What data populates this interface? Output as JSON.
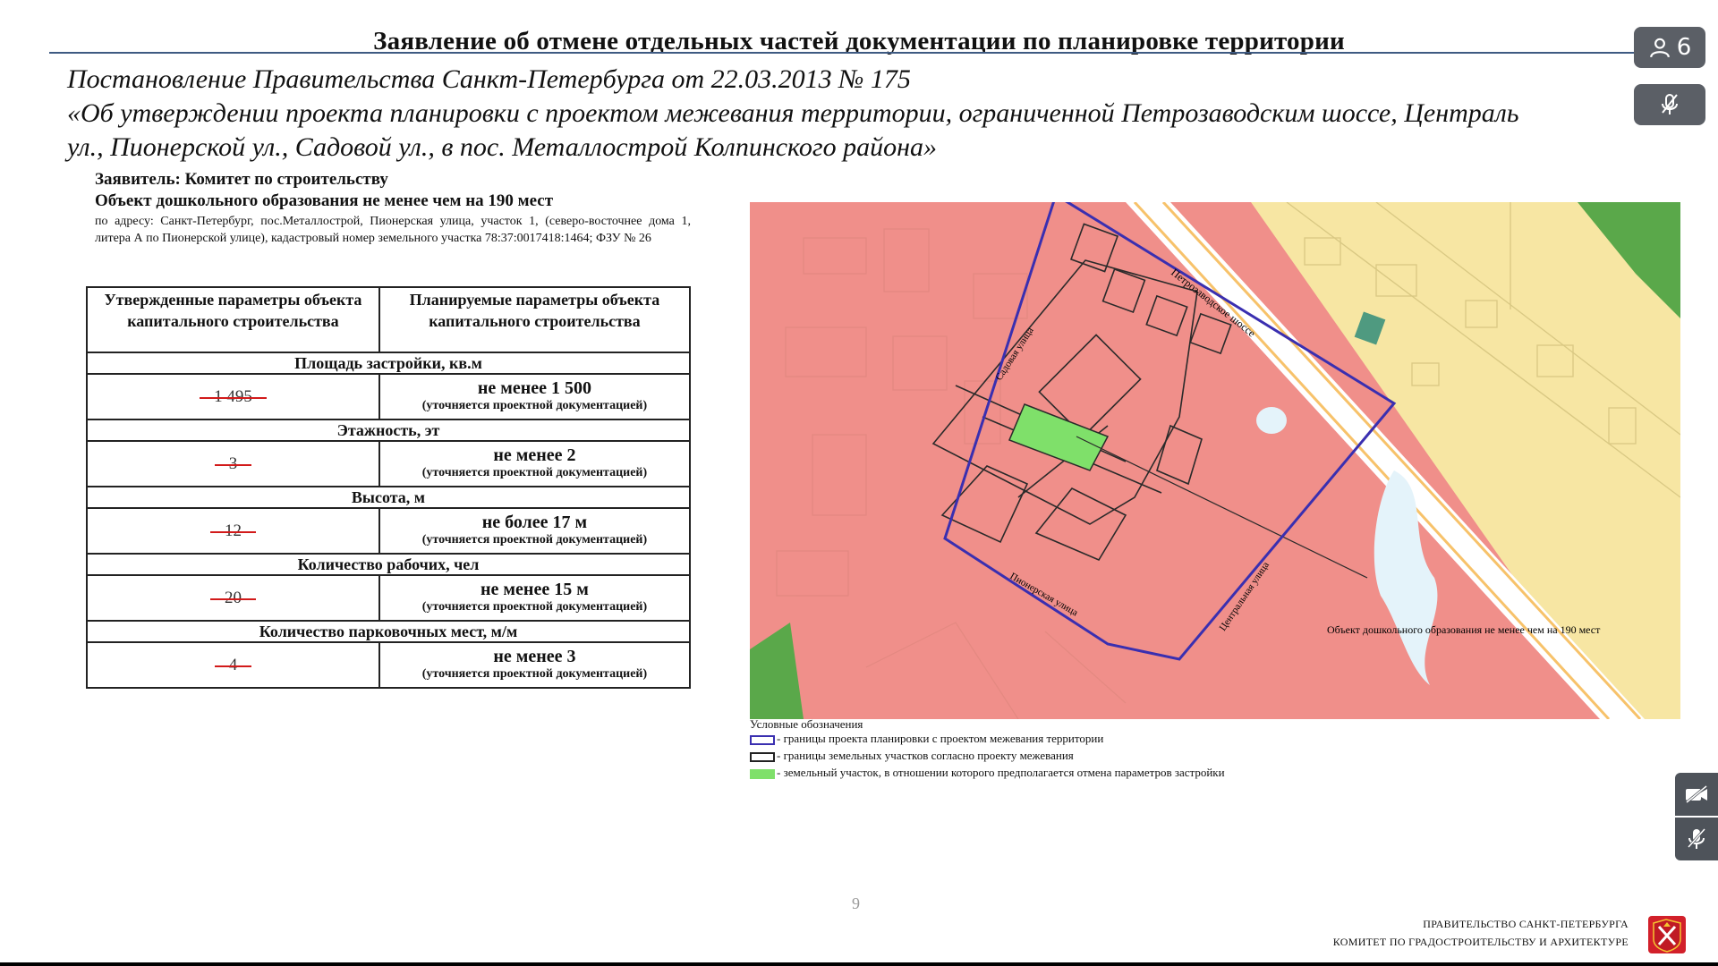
{
  "slide": {
    "title": "Заявление об отмене отдельных частей документации по планировке территории",
    "subtitle_lines": [
      "Постановление Правительства Санкт-Петербурга от 22.03.2013  № 175",
      "«Об утверждении проекта планировки с проектом межевания  территории, ограниченной Петрозаводским шоссе, Централь",
      "ул., Пионерской ул., Садовой ул., в пос. Металлострой Колпинского района»"
    ],
    "applicant": "Заявитель: Комитет по строительству",
    "object": "Объект дошкольного образования не менее чем на 190 мест",
    "address": "по адресу: Санкт-Петербург, пос.Металлострой, Пионерская улица, участок 1, (северо-восточнее дома 1, литера А по Пионерской улице), кадастровый номер земельного участка 78:37:0017418:1464; ФЗУ № 26",
    "page_number": "9"
  },
  "table": {
    "col_headers": [
      "Утвержденные параметры объекта капитального строительства",
      "Планируемые параметры объекта капитального строительства"
    ],
    "note": "(уточняется проектной документацией)",
    "sections": [
      {
        "title": "Площадь застройки, кв.м",
        "old": "1 495",
        "new": "не менее 1 500"
      },
      {
        "title": "Этажность, эт",
        "old": "3",
        "new": "не менее 2"
      },
      {
        "title": "Высота, м",
        "old": "12",
        "new": "не более 17 м"
      },
      {
        "title": "Количество рабочих, чел",
        "old": "20",
        "new": "не менее 15 м"
      },
      {
        "title": "Количество парковочных мест, м/м",
        "old": "4",
        "new": "не менее 3"
      }
    ]
  },
  "map": {
    "streets": {
      "petrozavodskoe": "Петрозаводское шоссе",
      "sadovaya": "Садовая улица",
      "pionerskaya": "Пионерская улица",
      "centralnaya": "Центральная улица"
    },
    "callout": "Объект дошкольного образования не менее чем на 190 мест",
    "colors": {
      "zone": "#f08f8a",
      "residential": "#f7e6a3",
      "highlight": "#7fe06a",
      "boundary": "#3a2fb0",
      "water": "#e4f3fa",
      "green": "#5aa84a"
    }
  },
  "legend": {
    "title": "Условные обозначения",
    "items": [
      {
        "color": "#3a2fb0",
        "label": "- границы проекта планировки с проектом межевания территории"
      },
      {
        "color": "#222222",
        "label": "- границы земельных участков согласно проекту межевания"
      },
      {
        "color": "#7fe06a",
        "label": "- земельный участок, в отношении которого предполагается отмена параметров застройки"
      }
    ]
  },
  "footer": {
    "line1": "ПРАВИТЕЛЬСТВО САНКТ-ПЕТЕРБУРГА",
    "line2": "КОМИТЕТ ПО ГРАДОСТРОИТЕЛЬСТВУ И АРХИТЕКТУРЕ"
  },
  "controls": {
    "participants_count": "6",
    "participants_icon": "person-icon",
    "mic_icon": "microphone-muted-icon",
    "side_icons": [
      "camera-off-icon",
      "microphone-off-icon"
    ]
  }
}
